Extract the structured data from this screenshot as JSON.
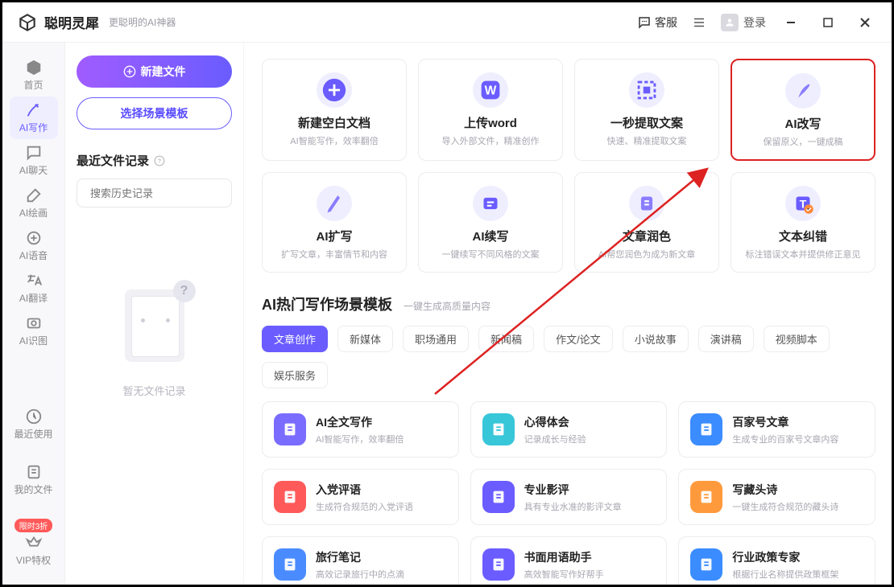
{
  "titlebar": {
    "app_name": "聪明灵犀",
    "tagline": "更聪明的AI神器",
    "service": "客服",
    "login": "登录"
  },
  "nav": {
    "items": [
      {
        "key": "home",
        "label": "首页"
      },
      {
        "key": "write",
        "label": "AI写作"
      },
      {
        "key": "chat",
        "label": "AI聊天"
      },
      {
        "key": "paint",
        "label": "AI绘画"
      },
      {
        "key": "voice",
        "label": "AI语音"
      },
      {
        "key": "trans",
        "label": "AI翻译"
      },
      {
        "key": "img",
        "label": "AI识图"
      }
    ],
    "tail": [
      {
        "key": "recent",
        "label": "最近使用"
      },
      {
        "key": "myfiles",
        "label": "我的文件"
      },
      {
        "key": "vip",
        "label": "VIP特权",
        "badge": "限时3折"
      }
    ]
  },
  "filescol": {
    "new_file": "新建文件",
    "choose_template": "选择场景模板",
    "recent_title": "最近文件记录",
    "search_placeholder": "搜索历史记录",
    "empty": "暂无文件记录"
  },
  "action_cards": [
    {
      "icon": "plus-icon",
      "title": "新建空白文档",
      "desc": "AI智能写作，效率翻倍",
      "bg": "#6a5cff"
    },
    {
      "icon": "word-icon",
      "title": "上传word",
      "desc": "导入外部文件，精准创作",
      "bg": "#6a5cff"
    },
    {
      "icon": "extract-icon",
      "title": "一秒提取文案",
      "desc": "快速、精准提取文案",
      "bg": "#6a5cff"
    },
    {
      "icon": "rewrite-icon",
      "title": "AI改写",
      "desc": "保留原义，一键成稿",
      "bg": "#8a7dff",
      "highlight": true
    },
    {
      "icon": "expand-icon",
      "title": "AI扩写",
      "desc": "扩写文章，丰富情节和内容",
      "bg": "#8a7dff"
    },
    {
      "icon": "continue-icon",
      "title": "AI续写",
      "desc": "一键续写不同风格的文案",
      "bg": "#6a5cff"
    },
    {
      "icon": "polish-icon",
      "title": "文章润色",
      "desc": "AI帮您润色为成为新文章",
      "bg": "#8a7dff"
    },
    {
      "icon": "correct-icon",
      "title": "文本纠错",
      "desc": "标注错误文本并提供修正意见",
      "bg": "#6a5cff"
    }
  ],
  "hot_section": {
    "title": "AI热门写作场景模板",
    "subtitle": "一键生成高质量内容"
  },
  "tabs": [
    "文章创作",
    "新媒体",
    "职场通用",
    "新闻稿",
    "作文/论文",
    "小说故事",
    "演讲稿",
    "视频脚本",
    "娱乐服务"
  ],
  "active_tab": 0,
  "templates": [
    {
      "color": "#7a6cff",
      "title": "AI全文写作",
      "desc": "AI智能写作，效率翻倍"
    },
    {
      "color": "#38c6d9",
      "title": "心得体会",
      "desc": "记录成长与经验"
    },
    {
      "color": "#3a8cff",
      "title": "百家号文章",
      "desc": "生成专业的百家号文章内容"
    },
    {
      "color": "#ff5a5a",
      "title": "入党评语",
      "desc": "生成符合规范的入党评语"
    },
    {
      "color": "#6a5cff",
      "title": "专业影评",
      "desc": "具有专业水准的影评文章"
    },
    {
      "color": "#ff9a3c",
      "title": "写藏头诗",
      "desc": "一键生成符合规范的藏头诗"
    },
    {
      "color": "#4a8cff",
      "title": "旅行笔记",
      "desc": "高效记录旅行中的点滴"
    },
    {
      "color": "#6a5cff",
      "title": "书面用语助手",
      "desc": "高效智能写作好帮手"
    },
    {
      "color": "#3a8cff",
      "title": "行业政策专家",
      "desc": "根据行业名称提供政策框架"
    }
  ]
}
